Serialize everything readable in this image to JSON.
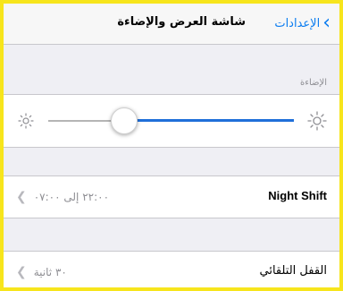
{
  "navbar": {
    "back_label": "الإعدادات",
    "title": "شاشة العرض والإضاءة"
  },
  "brightness": {
    "section_header": "الإضاءة",
    "level_percent": 25
  },
  "night_shift": {
    "title": "Night Shift",
    "detail": "٢٢:٠٠ إلى ٠٧:٠٠"
  },
  "auto_lock": {
    "title": "القفل التلقائي",
    "detail": "٣٠ ثانية"
  },
  "colors": {
    "accent": "#0a7cf0",
    "slider_fill": "#1f6fd9",
    "frame_border": "#f7e51c",
    "background": "#efeff4"
  },
  "icons": {
    "back": "chevron-left-icon",
    "disclosure": "chevron-left-icon",
    "brightness_low": "sun-small-icon",
    "brightness_high": "sun-large-icon"
  }
}
